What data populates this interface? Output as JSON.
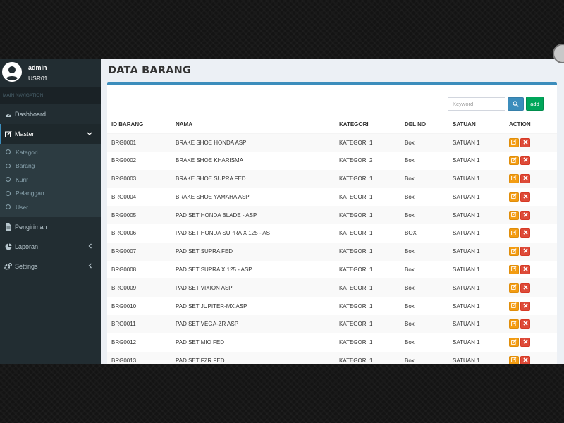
{
  "user": {
    "name": "admin",
    "id": "USR01"
  },
  "sidebar": {
    "header": "MAIN NAVIGATION",
    "items": [
      {
        "label": "Dashboard",
        "icon": "dashboard-icon"
      },
      {
        "label": "Master",
        "icon": "edit-icon"
      },
      {
        "label": "Pengiriman",
        "icon": "file-icon"
      },
      {
        "label": "Laporan",
        "icon": "pie-chart-icon"
      },
      {
        "label": "Settings",
        "icon": "cogs-icon"
      }
    ],
    "submenu": [
      {
        "label": "Kategori"
      },
      {
        "label": "Barang"
      },
      {
        "label": "Kurir"
      },
      {
        "label": "Pelanggan"
      },
      {
        "label": "User"
      }
    ]
  },
  "page": {
    "title": "DATA BARANG"
  },
  "search": {
    "placeholder": "Keyword",
    "add_label": "add"
  },
  "table": {
    "headers": [
      "ID BARANG",
      "NAMA",
      "KATEGORI",
      "DEL NO",
      "SATUAN",
      "ACTION"
    ],
    "rows": [
      [
        "BRG0001",
        "BRAKE SHOE HONDA ASP",
        "KATEGORI 1",
        "Box",
        "SATUAN 1"
      ],
      [
        "BRG0002",
        "BRAKE SHOE KHARISMA",
        "KATEGORI 2",
        "Box",
        "SATUAN 1"
      ],
      [
        "BRG0003",
        "BRAKE SHOE SUPRA FED",
        "KATEGORI 1",
        "Box",
        "SATUAN 1"
      ],
      [
        "BRG0004",
        "BRAKE SHOE YAMAHA ASP",
        "KATEGORI 1",
        "Box",
        "SATUAN 1"
      ],
      [
        "BRG0005",
        "PAD SET HONDA BLADE - ASP",
        "KATEGORI 1",
        "Box",
        "SATUAN 1"
      ],
      [
        "BRG0006",
        "PAD SET HONDA SUPRA X 125 - AS",
        "KATEGORI 1",
        "BOX",
        "SATUAN 1"
      ],
      [
        "BRG0007",
        "PAD SET SUPRA FED",
        "KATEGORI 1",
        "Box",
        "SATUAN 1"
      ],
      [
        "BRG0008",
        "PAD SET SUPRA X 125 - ASP",
        "KATEGORI 1",
        "Box",
        "SATUAN 1"
      ],
      [
        "BRG0009",
        "PAD SET VIXION ASP",
        "KATEGORI 1",
        "Box",
        "SATUAN 1"
      ],
      [
        "BRG0010",
        "PAD SET JUPITER-MX ASP",
        "KATEGORI 1",
        "Box",
        "SATUAN 1"
      ],
      [
        "BRG0011",
        "PAD SET VEGA-ZR ASP",
        "KATEGORI 1",
        "Box",
        "SATUAN 1"
      ],
      [
        "BRG0012",
        "PAD SET MIO FED",
        "KATEGORI 1",
        "Box",
        "SATUAN 1"
      ],
      [
        "BRG0013",
        "PAD SET FZR FED",
        "KATEGORI 1",
        "Box",
        "SATUAN 1"
      ]
    ]
  },
  "colors": {
    "sidebar": "#222d32",
    "primary": "#3c8dbc",
    "success": "#00a65a",
    "warning": "#f39c12",
    "danger": "#dd4b39"
  }
}
